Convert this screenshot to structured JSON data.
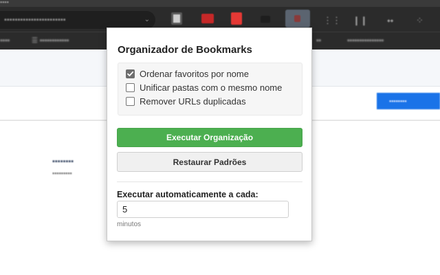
{
  "popup": {
    "title": "Organizador de Bookmarks",
    "options": [
      {
        "label": "Ordenar favoritos por nome",
        "checked": true
      },
      {
        "label": "Unificar pastas com o mesmo nome",
        "checked": false
      },
      {
        "label": "Remover URLs duplicadas",
        "checked": false
      }
    ],
    "run_button": "Executar Organização",
    "reset_button": "Restaurar Padrões",
    "auto_label": "Executar automaticamente a cada:",
    "interval_value": "5",
    "interval_unit": "minutos"
  },
  "colors": {
    "run_button_bg": "#4caf50",
    "reset_button_bg": "#f0f0f0",
    "browser_chrome": "#2b2b2b",
    "page_action_blue": "#1a73e8"
  },
  "icons": [
    "chevron-down-icon",
    "extension-icon",
    "check-icon",
    "menu-icon"
  ]
}
